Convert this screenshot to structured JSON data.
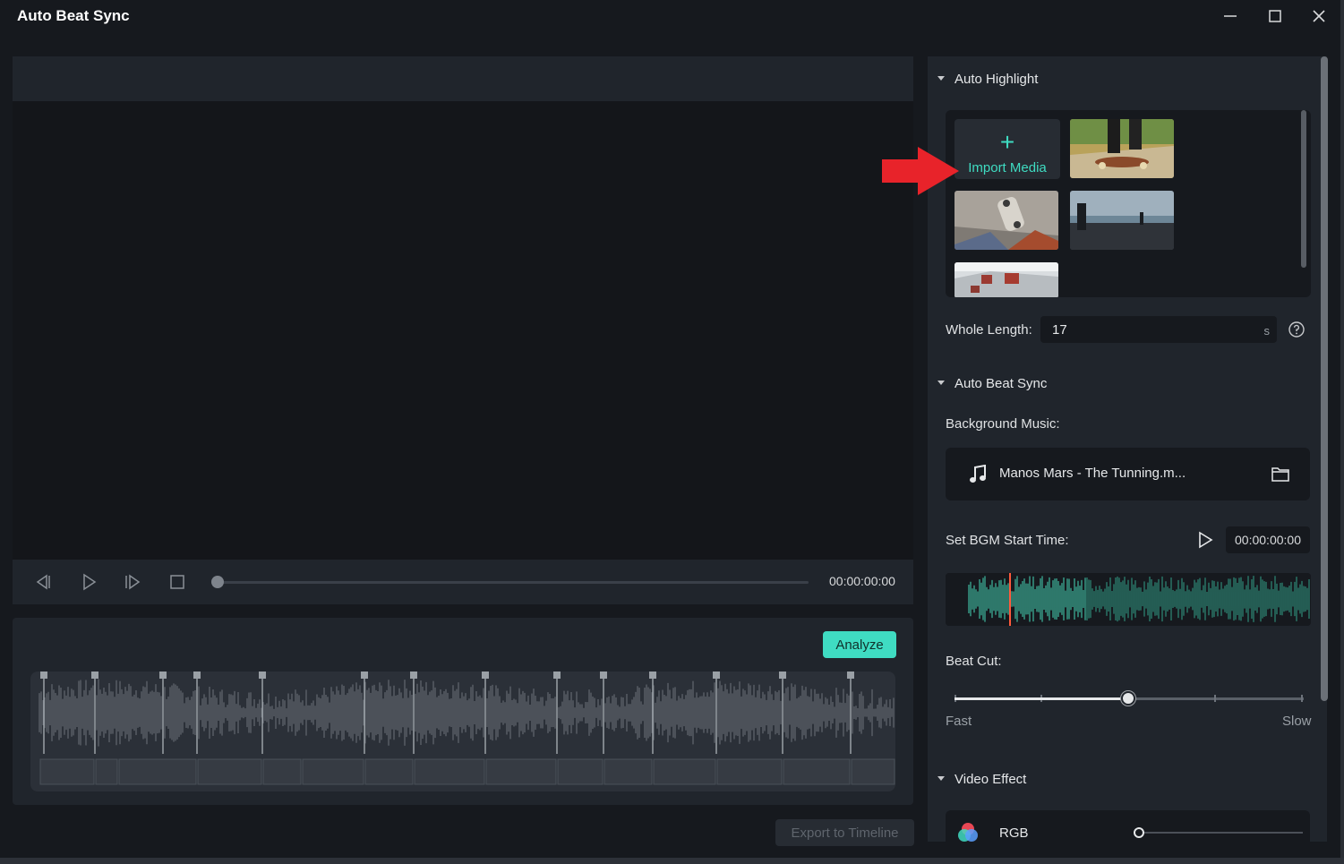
{
  "window": {
    "title": "Auto Beat Sync",
    "controls": [
      "minimize",
      "maximize",
      "close"
    ]
  },
  "player": {
    "time": "00:00:00:00",
    "icons": [
      "prev-frame-icon",
      "play-icon",
      "next-frame-icon",
      "stop-icon"
    ]
  },
  "beat_panel": {
    "analyze_label": "Analyze"
  },
  "export": {
    "label": "Export to Timeline"
  },
  "auto_highlight": {
    "title": "Auto Highlight",
    "import_label": "Import Media",
    "import_symbol": "+",
    "clips": [
      "skateboard-feet",
      "skateboard-underside",
      "beach-rail",
      "skate-ramp"
    ],
    "whole_length_label": "Whole Length:",
    "whole_length_value": "17",
    "whole_length_unit": "s"
  },
  "auto_beat_sync": {
    "title": "Auto Beat Sync",
    "bg_music_label": "Background Music:",
    "music_file": "Manos Mars - The Tunning.m...",
    "bgm_start_label": "Set BGM Start Time:",
    "bgm_start_time": "00:00:00:00",
    "beat_cut_label": "Beat Cut:",
    "beat_cut_level": 0.5,
    "fast_label": "Fast",
    "slow_label": "Slow"
  },
  "video_effect": {
    "title": "Video Effect",
    "effect_name": "RGB",
    "effect_level": 0
  },
  "colors": {
    "accent": "#3fdcc2",
    "annotation_arrow": "#e8232a",
    "playhead": "#ff5a3c"
  }
}
